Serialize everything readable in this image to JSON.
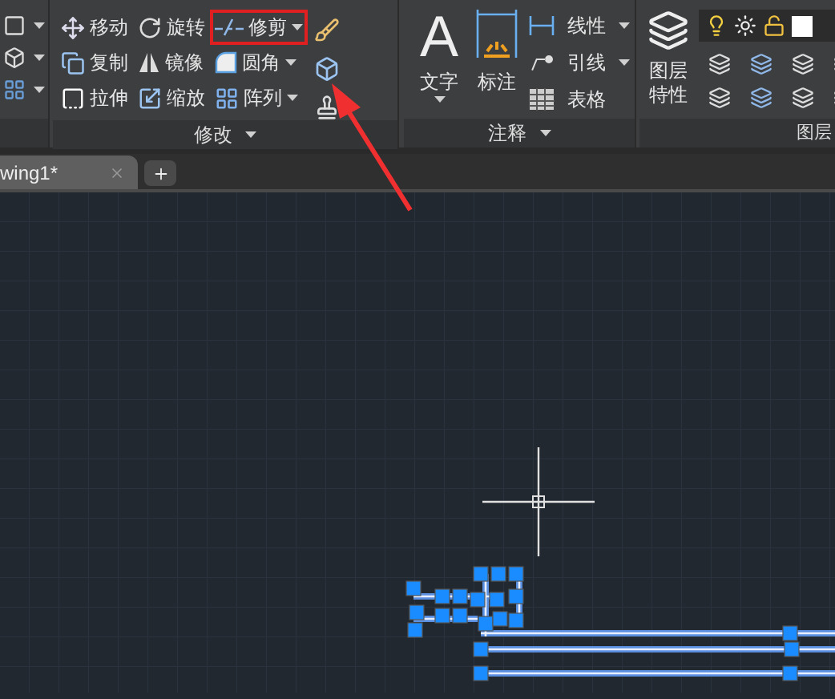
{
  "ribbon": {
    "modify_panel": {
      "title": "修改",
      "tools": [
        {
          "label": "移动",
          "dropdown": false,
          "highlighted": false
        },
        {
          "label": "复制",
          "dropdown": false,
          "highlighted": false
        },
        {
          "label": "拉伸",
          "dropdown": false,
          "highlighted": false
        },
        {
          "label": "旋转",
          "dropdown": false,
          "highlighted": false
        },
        {
          "label": "镜像",
          "dropdown": false,
          "highlighted": false
        },
        {
          "label": "缩放",
          "dropdown": false,
          "highlighted": false
        },
        {
          "label": "修剪",
          "dropdown": true,
          "highlighted": true
        },
        {
          "label": "圆角",
          "dropdown": true,
          "highlighted": false
        },
        {
          "label": "阵列",
          "dropdown": true,
          "highlighted": false
        }
      ]
    },
    "annotation_panel": {
      "title": "注释",
      "text_button": {
        "icon_glyph": "A",
        "label": "文字"
      },
      "dimension_button": {
        "label": "标注"
      },
      "tools": [
        {
          "label": "线性",
          "dropdown": true
        },
        {
          "label": "引线",
          "dropdown": true
        },
        {
          "label": "表格",
          "dropdown": false
        }
      ]
    },
    "layers_panel": {
      "title": "图层",
      "properties_button": {
        "label": "图层特性"
      }
    }
  },
  "tabs": [
    {
      "label": "wing1*",
      "selected": true
    }
  ]
}
